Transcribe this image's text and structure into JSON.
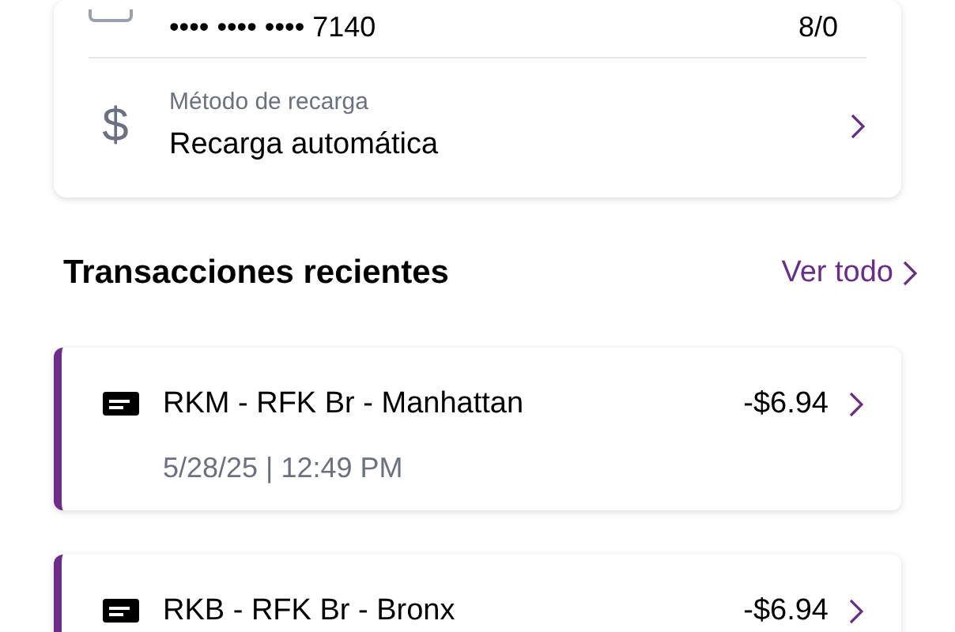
{
  "payment_card": {
    "card_number": "•••• •••• •••• 7140",
    "expiry": "8/0",
    "reload_icon": "$",
    "reload_label": "Método de recarga",
    "reload_value": "Recarga automática"
  },
  "recent_transactions": {
    "title": "Transacciones recientes",
    "view_all": "Ver todo",
    "items": [
      {
        "title": "RKM - RFK Br - Manhattan",
        "amount": "-$6.94",
        "datetime": "5/28/25 | 12:49 PM"
      },
      {
        "title": "RKB - RFK Br - Bronx",
        "amount": "-$6.94"
      }
    ]
  }
}
